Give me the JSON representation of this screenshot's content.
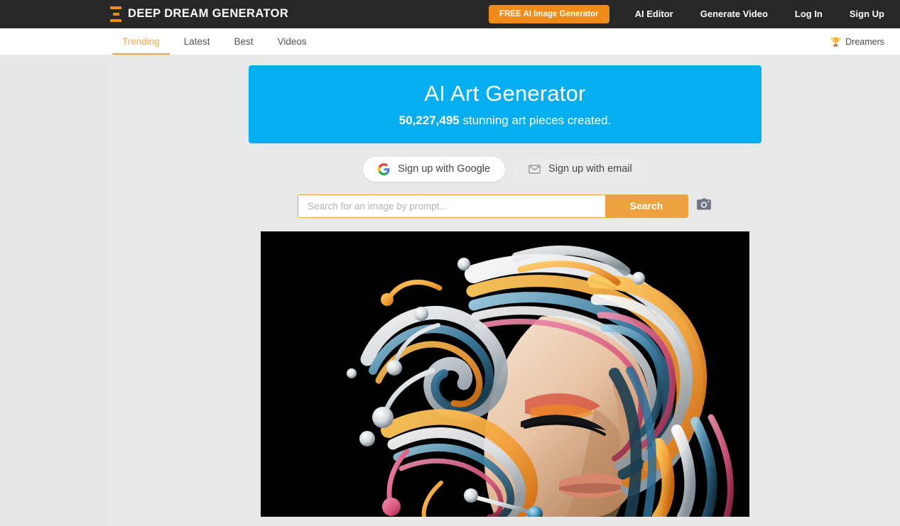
{
  "header": {
    "brand_name": "DEEP DREAM GENERATOR",
    "brand_icon": "hourglass-logo-icon",
    "cta_label": "FREE AI Image Generator",
    "nav": [
      {
        "label": "AI Editor",
        "name": "ai-editor"
      },
      {
        "label": "Generate Video",
        "name": "generate-video"
      },
      {
        "label": "Log In",
        "name": "log-in"
      },
      {
        "label": "Sign Up",
        "name": "sign-up"
      }
    ]
  },
  "subnav": {
    "tabs": [
      {
        "label": "Trending",
        "active": true
      },
      {
        "label": "Latest",
        "active": false
      },
      {
        "label": "Best",
        "active": false
      },
      {
        "label": "Videos",
        "active": false
      }
    ],
    "dreamers_label": "Dreamers",
    "dreamers_icon": "trophy-icon"
  },
  "hero": {
    "title": "AI Art Generator",
    "count": "50,227,495",
    "subtitle_rest": " stunning art pieces created.",
    "background_color": "#06aeef"
  },
  "signup": {
    "google_label": "Sign up with Google",
    "google_icon": "google-g-icon",
    "email_label": "Sign up with email",
    "email_icon": "envelope-icon"
  },
  "search": {
    "placeholder": "Search for an image by prompt...",
    "value": "",
    "button_label": "Search",
    "camera_icon": "camera-icon"
  },
  "artwork": {
    "alt": "AI generated portrait of a woman with flowing multicolor swirling hair",
    "palette": {
      "background": "#000000",
      "orange": "#f2a13a",
      "deep_orange": "#e06a16",
      "blue": "#2e6f96",
      "light_blue": "#7fb6d4",
      "white": "#f2f4f6",
      "pink": "#d9567e",
      "skin": "#e8c3a4"
    }
  },
  "colors": {
    "header_bg": "#272727",
    "accent_orange": "#ef8c19",
    "tab_active": "#efa94a",
    "page_bg": "#e7e7e7"
  }
}
